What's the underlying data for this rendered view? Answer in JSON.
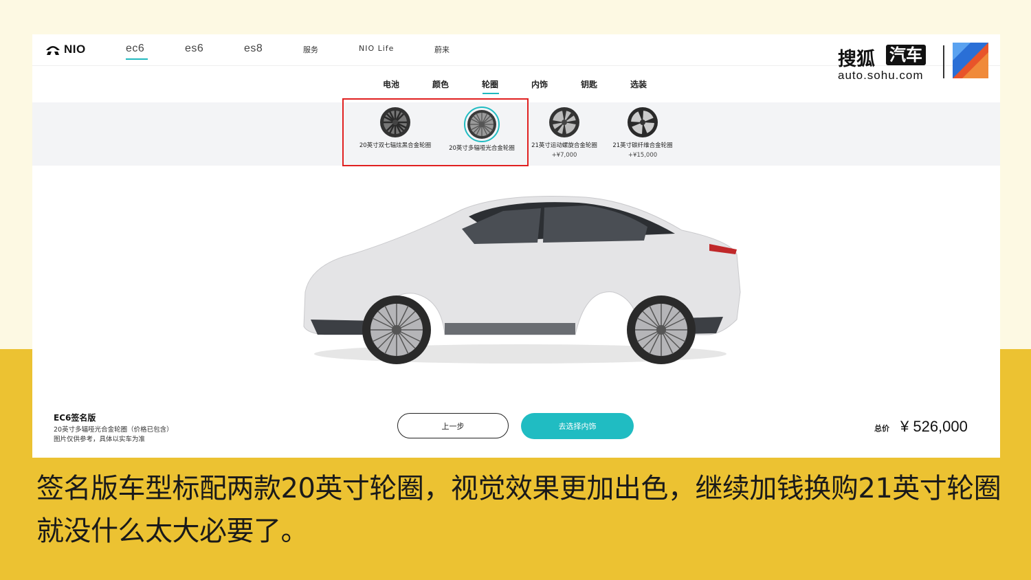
{
  "nav": {
    "brand": "NIO",
    "items": [
      "ec6",
      "es6",
      "es8",
      "服务",
      "NIO Life",
      "蔚来"
    ],
    "active": "ec6"
  },
  "watermark": {
    "cn": "搜狐",
    "box": "汽车",
    "url": "auto.sohu.com"
  },
  "subtabs": [
    "电池",
    "颜色",
    "轮圈",
    "内饰",
    "钥匙",
    "选装"
  ],
  "active_subtab": "轮圈",
  "wheels": [
    {
      "name": "20英寸双七辐炫黑合金轮圈",
      "price": ""
    },
    {
      "name": "20英寸多辐哑光合金轮圈",
      "price": "",
      "selected": true
    },
    {
      "name": "21英寸运动螺旋合金轮圈",
      "price": "+¥7,000"
    },
    {
      "name": "21英寸碳纤维合金轮圈",
      "price": "+¥15,000"
    }
  ],
  "summary": {
    "title": "EC6签名版",
    "line1": "20英寸多辐哑光合金轮圈（价格已包含）",
    "line2": "图片仅供参考，具体以实车为准"
  },
  "buttons": {
    "prev": "上一步",
    "next": "去选择内饰"
  },
  "total": {
    "label": "总价",
    "price": "¥ 526,000"
  },
  "caption": "签名版车型标配两款20英寸轮圈，视觉效果更加出色，继续加钱换购21英寸轮圈就没什么太大必要了。",
  "colors": {
    "accent": "#20bcc2",
    "highlight_box": "#e02020",
    "band": "#ecc232"
  }
}
